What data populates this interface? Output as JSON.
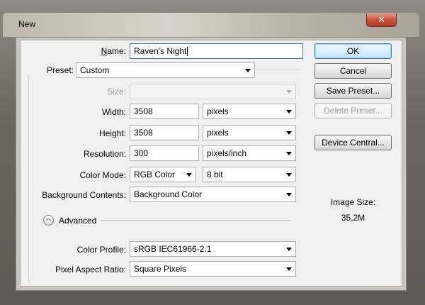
{
  "window": {
    "title": "New",
    "close_glyph": "✕"
  },
  "form": {
    "name_label": "Name:",
    "name_value": "Raven's Night",
    "preset_label": "Preset:",
    "preset_value": "Custom",
    "size_label": "Size:",
    "size_value": "",
    "width_label": "Width:",
    "width_value": "3508",
    "width_unit": "pixels",
    "height_label": "Height:",
    "height_value": "3508",
    "height_unit": "pixels",
    "resolution_label": "Resolution:",
    "resolution_value": "300",
    "resolution_unit": "pixels/inch",
    "color_mode_label": "Color Mode:",
    "color_mode_value": "RGB Color",
    "bit_depth_value": "8 bit",
    "background_label": "Background Contents:",
    "background_value": "Background Color",
    "advanced_label": "Advanced",
    "color_profile_label": "Color Profile:",
    "color_profile_value": "sRGB IEC61966-2.1",
    "pixel_aspect_label": "Pixel Aspect Ratio:",
    "pixel_aspect_value": "Square Pixels"
  },
  "buttons": {
    "ok": "OK",
    "cancel": "Cancel",
    "save_preset": "Save Preset...",
    "delete_preset": "Delete Preset...",
    "device_central": "Device Central..."
  },
  "info": {
    "image_size_label": "Image Size:",
    "image_size_value": "35,2M"
  }
}
